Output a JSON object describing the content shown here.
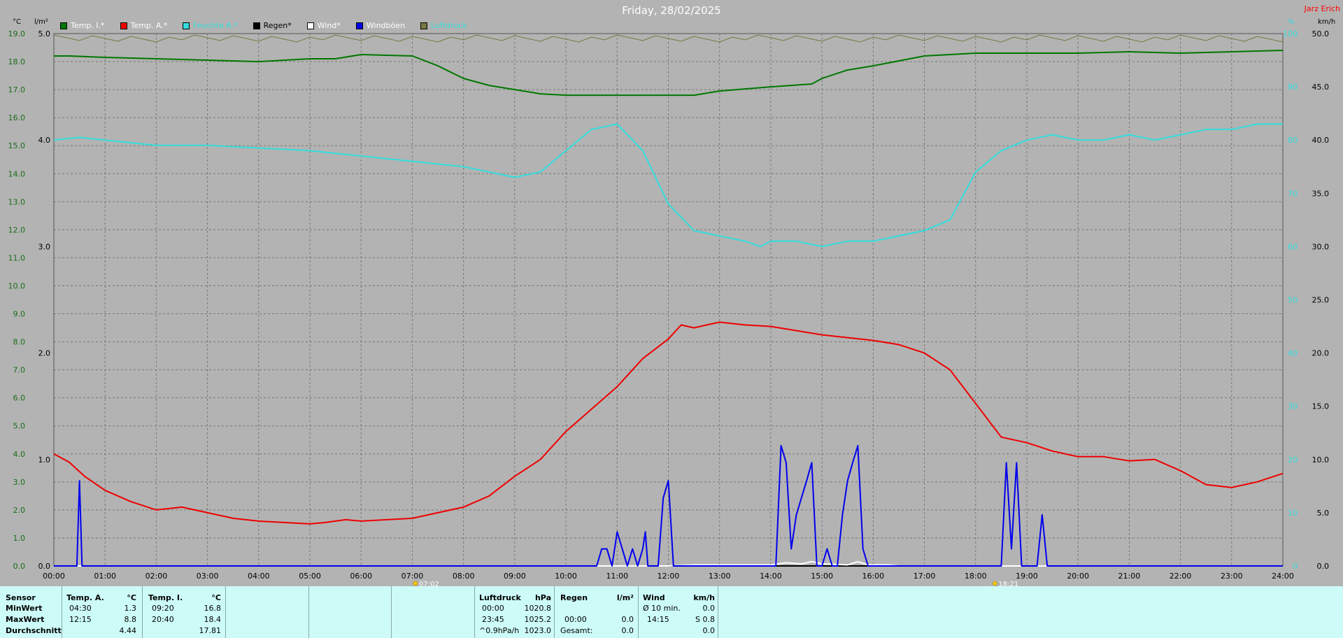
{
  "title": "Friday, 28/02/2025",
  "brand": "Jarz Erich",
  "colors": {
    "background": "#b3b3b3",
    "temp_indoor": "#007700",
    "temp_outdoor": "#ee0000",
    "humidity": "#33dddd",
    "rain": "#000000",
    "wind": "#ffffff",
    "gusts": "#0000ee",
    "pressure": "#777744",
    "panel": "#cdfbf8"
  },
  "legend": [
    {
      "label": "Temp. I.*",
      "color": "#007700"
    },
    {
      "label": "Temp. A.*",
      "color": "#ee0000"
    },
    {
      "label": "Feuchte A.*",
      "color": "#33dddd"
    },
    {
      "label": "Regen*",
      "color": "#000000"
    },
    {
      "label": "Wind*",
      "color": "#ffffff"
    },
    {
      "label": "Windböen",
      "color": "#0000ee"
    },
    {
      "label": "Luftdruck",
      "color": "#777744"
    }
  ],
  "axes": {
    "left_unit": "°C",
    "rain_unit": "l/m²",
    "hum_unit": "%",
    "wind_unit": "km/h",
    "temp_ticks": [
      "0.0",
      "1.0",
      "2.0",
      "3.0",
      "4.0",
      "5.0",
      "6.0",
      "7.0",
      "8.0",
      "9.0",
      "10.0",
      "11.0",
      "12.0",
      "13.0",
      "14.0",
      "15.0",
      "16.0",
      "17.0",
      "18.0",
      "19.0"
    ],
    "rain_ticks": [
      "0.0",
      "1.0",
      "2.0",
      "3.0",
      "4.0",
      "5.0"
    ],
    "hum_ticks": [
      "0",
      "10",
      "20",
      "30",
      "40",
      "50",
      "60",
      "70",
      "80",
      "90",
      "100"
    ],
    "wind_ticks": [
      "0.0",
      "5.0",
      "10.0",
      "15.0",
      "20.0",
      "25.0",
      "30.0",
      "35.0",
      "40.0",
      "45.0",
      "50.0"
    ],
    "x_ticks": [
      "00:00",
      "01:00",
      "02:00",
      "03:00",
      "04:00",
      "05:00",
      "06:00",
      "07:00",
      "08:00",
      "09:00",
      "10:00",
      "11:00",
      "12:00",
      "13:00",
      "14:00",
      "15:00",
      "16:00",
      "17:00",
      "18:00",
      "19:00",
      "20:00",
      "21:00",
      "22:00",
      "23:00",
      "24:00"
    ],
    "sunrise": "07:02",
    "sunset": "18:21"
  },
  "chart_data": {
    "type": "line",
    "xlim_hours": [
      0,
      24
    ],
    "temp_ylim": [
      0,
      19
    ],
    "rain_ylim": [
      0,
      5
    ],
    "hum_ylim": [
      0,
      100
    ],
    "wind_ylim": [
      0,
      50
    ],
    "series": [
      {
        "name": "Temp. I.*",
        "axis": "temp",
        "x": [
          0,
          0.3,
          1,
          2,
          3,
          4,
          5,
          5.5,
          6,
          7,
          7.5,
          8,
          8.5,
          9,
          9.5,
          10,
          11,
          12,
          12.5,
          13,
          14,
          14.8,
          15,
          15.5,
          16,
          17,
          18,
          19,
          20,
          21,
          22,
          23,
          24
        ],
        "values": [
          18.2,
          18.2,
          18.15,
          18.1,
          18.05,
          18.0,
          18.1,
          18.1,
          18.25,
          18.2,
          17.85,
          17.4,
          17.15,
          17.0,
          16.85,
          16.8,
          16.8,
          16.8,
          16.8,
          16.95,
          17.1,
          17.2,
          17.4,
          17.7,
          17.85,
          18.2,
          18.3,
          18.3,
          18.3,
          18.35,
          18.3,
          18.35,
          18.4
        ]
      },
      {
        "name": "Temp. A.*",
        "axis": "temp",
        "x": [
          0,
          0.3,
          0.6,
          1,
          1.5,
          2,
          2.5,
          3,
          3.5,
          4,
          4.5,
          5,
          5.3,
          5.7,
          6,
          6.5,
          7,
          7.5,
          8,
          8.5,
          9,
          9.5,
          10,
          10.5,
          11,
          11.5,
          12,
          12.25,
          12.5,
          12.75,
          13,
          13.5,
          14,
          14.5,
          15,
          15.5,
          16,
          16.5,
          17,
          17.5,
          18,
          18.5,
          19,
          19.5,
          20,
          20.5,
          21,
          21.5,
          22,
          22.5,
          23,
          23.5,
          24
        ],
        "values": [
          4.0,
          3.7,
          3.2,
          2.7,
          2.3,
          2.0,
          2.1,
          1.9,
          1.7,
          1.6,
          1.55,
          1.5,
          1.55,
          1.65,
          1.6,
          1.65,
          1.7,
          1.9,
          2.1,
          2.5,
          3.2,
          3.8,
          4.8,
          5.6,
          6.4,
          7.4,
          8.1,
          8.6,
          8.5,
          8.6,
          8.7,
          8.6,
          8.55,
          8.4,
          8.25,
          8.15,
          8.05,
          7.9,
          7.6,
          7.0,
          5.8,
          4.6,
          4.4,
          4.1,
          3.9,
          3.9,
          3.75,
          3.8,
          3.4,
          2.9,
          2.8,
          3.0,
          3.3
        ]
      },
      {
        "name": "Feuchte A.*",
        "axis": "hum",
        "x": [
          0,
          0.5,
          1,
          2,
          3,
          4,
          5,
          6,
          7,
          7.5,
          8,
          8.5,
          9,
          9.5,
          10,
          10.5,
          11,
          11.5,
          12,
          12.5,
          13,
          13.5,
          13.8,
          14,
          14.5,
          15,
          15.5,
          16,
          17,
          17.5,
          18,
          18.5,
          19,
          19.5,
          20,
          20.5,
          21,
          21.5,
          22,
          22.5,
          23,
          23.5,
          24
        ],
        "values": [
          80,
          80.5,
          80,
          79,
          79,
          78.5,
          78,
          77,
          76,
          75.5,
          75,
          74,
          73,
          74,
          78,
          82,
          83,
          78,
          68,
          63,
          62,
          61,
          60,
          61,
          61,
          60,
          61,
          61,
          63,
          65,
          74,
          78,
          80,
          81,
          80,
          80,
          81,
          80,
          81,
          82,
          82,
          83,
          83
        ]
      },
      {
        "name": "Regen*",
        "axis": "rain",
        "x": [
          0,
          24
        ],
        "values": [
          0,
          0
        ]
      },
      {
        "name": "Wind*",
        "axis": "wind",
        "x": [
          0,
          12,
          12.5,
          14,
          14.3,
          14.6,
          14.8,
          15,
          15.5,
          15.7,
          15.9,
          16.3,
          16.5,
          24
        ],
        "values": [
          0,
          0,
          0.1,
          0.1,
          0.3,
          0.2,
          0.4,
          0.2,
          0.1,
          0.4,
          0.1,
          0.1,
          0,
          0
        ]
      },
      {
        "name": "Windböen",
        "axis": "wind",
        "x": [
          0,
          0.45,
          0.5,
          0.55,
          0.6,
          0.7,
          10,
          10.6,
          10.7,
          10.8,
          10.9,
          11,
          11.1,
          11.2,
          11.3,
          11.4,
          11.5,
          11.55,
          11.6,
          11.7,
          11.8,
          11.9,
          12,
          12.1,
          12.15,
          12.2,
          12.3,
          12.4,
          14,
          14.1,
          14.2,
          14.3,
          14.4,
          14.5,
          14.6,
          14.7,
          14.8,
          14.9,
          15,
          15.1,
          15.2,
          15.3,
          15.4,
          15.5,
          15.6,
          15.7,
          15.8,
          15.9,
          16,
          18.5,
          18.6,
          18.7,
          18.8,
          18.9,
          19,
          19.1,
          19.2,
          19.3,
          19.4,
          24
        ],
        "values": [
          0,
          0,
          8.0,
          0,
          0,
          0,
          0,
          0,
          1.6,
          1.6,
          0,
          3.2,
          1.6,
          0,
          1.6,
          0,
          1.6,
          3.2,
          0,
          0,
          0,
          6.4,
          8.0,
          0,
          0,
          0,
          0,
          0,
          0,
          0,
          11.3,
          9.7,
          1.6,
          4.8,
          6.4,
          8.0,
          9.7,
          0,
          0,
          1.6,
          0,
          0,
          4.8,
          8.0,
          9.7,
          11.3,
          1.6,
          0,
          0,
          0,
          9.7,
          1.6,
          9.7,
          0,
          0,
          0,
          0,
          4.8,
          0,
          0
        ]
      },
      {
        "name": "Luftdruck",
        "axis": "top",
        "x": [
          0,
          24
        ],
        "values": [
          1023.0,
          1023.0
        ]
      }
    ]
  },
  "panel": {
    "sensor": {
      "header": "Sensor",
      "rows": [
        "MinWert",
        "MaxWert",
        "Durchschnitt"
      ]
    },
    "temp_a": {
      "header": "Temp. A.",
      "unit": "°C",
      "min_time": "04:30",
      "min_val": "1.3",
      "max_time": "12:15",
      "max_val": "8.8",
      "avg": "4.44"
    },
    "temp_i": {
      "header": "Temp. I.",
      "unit": "°C",
      "min_time": "09:20",
      "min_val": "16.8",
      "max_time": "20:40",
      "max_val": "18.4",
      "avg": "17.81"
    },
    "pressure": {
      "header": "Luftdruck",
      "unit": "hPa",
      "r1_time": "00:00",
      "r1_val": "1020.8",
      "r2_time": "23:45",
      "r2_val": "1025.2",
      "r3_label": "^0.9hPa/h",
      "r3_val": "1023.0"
    },
    "rain": {
      "header": "Regen",
      "unit": "l/m²",
      "r2_time": "00:00",
      "r2_val": "0.0",
      "r3_label": "Gesamt:",
      "r3_val": "0.0"
    },
    "wind": {
      "header": "Wind",
      "unit": "km/h",
      "r1_label": "Ø 10 min.",
      "r1_val": "0.0",
      "r2_time": "14:15",
      "r2_val": "S 0.8",
      "r3_val": "0.0"
    }
  }
}
